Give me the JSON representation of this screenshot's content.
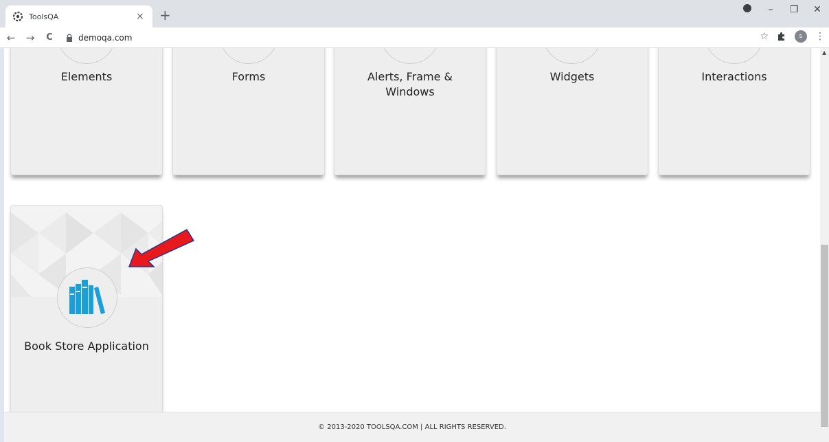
{
  "browser": {
    "tab_title": "ToolsQA",
    "tab_close": "×",
    "new_tab": "+",
    "url": "demoqa.com",
    "back": "←",
    "forward": "→",
    "reload": "C",
    "bookmark_star": "☆",
    "menu": "⋮",
    "avatar_letter": "s",
    "win_minimize": "–",
    "win_restore": "❐",
    "win_close": "✕"
  },
  "cards": [
    {
      "title": "Elements"
    },
    {
      "title": "Forms"
    },
    {
      "title": "Alerts, Frame & Windows"
    },
    {
      "title": "Widgets"
    },
    {
      "title": "Interactions"
    },
    {
      "title": "Book Store Application"
    }
  ],
  "footer": {
    "text": "© 2013-2020 TOOLSQA.COM | ALL RIGHTS RESERVED."
  },
  "colors": {
    "book_icon": "#1a9fd9",
    "arrow": "#e8191d",
    "card_bg": "#eeeeee"
  },
  "icons": [
    "toolsqa-favicon",
    "lock-icon",
    "star-icon",
    "puzzle-icon",
    "books-icon",
    "red-arrow"
  ]
}
